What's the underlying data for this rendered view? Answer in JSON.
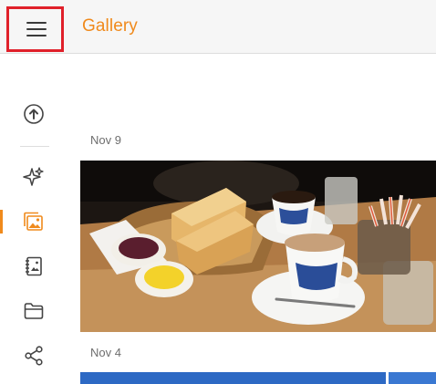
{
  "app": {
    "title": "Gallery",
    "accent_color": "#f08a1c",
    "highlight_color": "#e0202a"
  },
  "toolbar": {
    "menu_icon": "hamburger-menu-icon"
  },
  "nav": {
    "items": [
      {
        "icon": "upload-icon",
        "active": false
      },
      {
        "icon": "sparkle-icon",
        "active": false
      },
      {
        "icon": "photos-icon",
        "active": true
      },
      {
        "icon": "album-icon",
        "active": false
      },
      {
        "icon": "folder-icon",
        "active": false
      },
      {
        "icon": "share-icon",
        "active": false
      }
    ]
  },
  "gallery": {
    "groups": [
      {
        "date": "Nov 9",
        "photo": "breakfast-toast-coffee-photo"
      },
      {
        "date": "Nov 4",
        "photo": "blue-photo"
      }
    ]
  }
}
